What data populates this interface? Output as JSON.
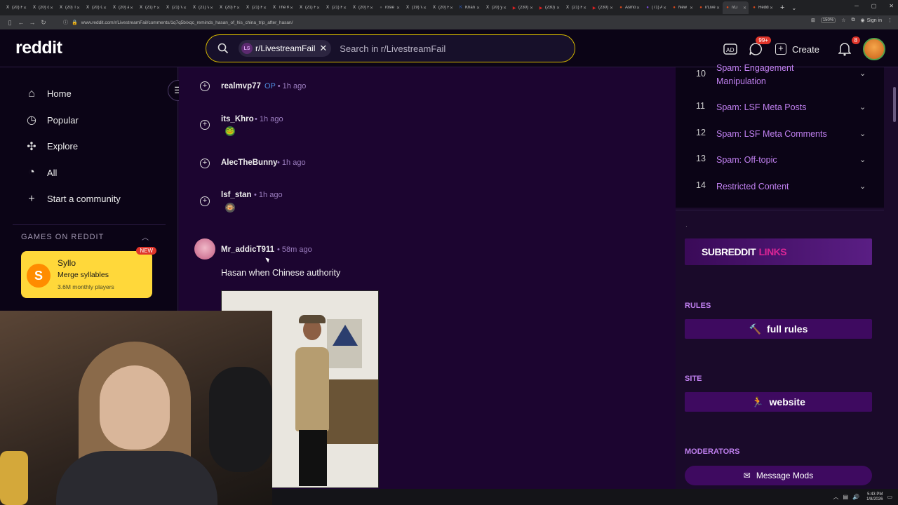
{
  "browser": {
    "tabs": [
      {
        "label": "(20) F",
        "fav": "X",
        "color": "#000000"
      },
      {
        "label": "(20) o",
        "fav": "X",
        "color": "#000000"
      },
      {
        "label": "(20) T",
        "fav": "X",
        "color": "#000000"
      },
      {
        "label": "(20) O",
        "fav": "X",
        "color": "#000000"
      },
      {
        "label": "(20) a",
        "fav": "X",
        "color": "#000000"
      },
      {
        "label": "(21) F",
        "fav": "X",
        "color": "#000000"
      },
      {
        "label": "(21) V",
        "fav": "X",
        "color": "#000000"
      },
      {
        "label": "(21) V",
        "fav": "X",
        "color": "#000000"
      },
      {
        "label": "(20) H",
        "fav": "X",
        "color": "#000000"
      },
      {
        "label": "(21) F",
        "fav": "X",
        "color": "#000000"
      },
      {
        "label": "The K",
        "fav": "X",
        "color": "#000000"
      },
      {
        "label": "(21) F",
        "fav": "X",
        "color": "#000000"
      },
      {
        "label": "(21) F",
        "fav": "X",
        "color": "#000000"
      },
      {
        "label": "(20) F",
        "fav": "X",
        "color": "#000000"
      },
      {
        "label": "rosie",
        "fav": "●",
        "color": "#555555"
      },
      {
        "label": "(19) V",
        "fav": "X",
        "color": "#000000"
      },
      {
        "label": "(20) F",
        "fav": "X",
        "color": "#000000"
      },
      {
        "label": "Khan",
        "fav": "K",
        "color": "#2b5dc9"
      },
      {
        "label": "(20) y",
        "fav": "X",
        "color": "#000000"
      },
      {
        "label": "(230)",
        "fav": "▶",
        "color": "#e02020"
      },
      {
        "label": "(230)",
        "fav": "▶",
        "color": "#e02020"
      },
      {
        "label": "(21) F",
        "fav": "X",
        "color": "#000000"
      },
      {
        "label": "(230)",
        "fav": "▶",
        "color": "#e02020"
      },
      {
        "label": "Asmo",
        "fav": "●",
        "color": "#e04a1a"
      },
      {
        "label": "(71) A",
        "fav": "●",
        "color": "#7a4bd8"
      },
      {
        "label": "New",
        "fav": "●",
        "color": "#e04a1a"
      },
      {
        "label": "r/Live",
        "fav": "●",
        "color": "#e04a1a"
      },
      {
        "label": "r/Li",
        "fav": "●",
        "color": "#e04a1a"
      },
      {
        "label": "Reddi",
        "fav": "●",
        "color": "#e04a1a"
      }
    ],
    "active_tab_index": 27,
    "url": "www.reddit.com/r/LivestreamFail/comments/1q7q5b/xqc_reminds_hasan_of_his_china_trip_after_hasan/",
    "zoom": "150%",
    "signin_label": "Sign in"
  },
  "header": {
    "logo": "reddit",
    "search_chip": "r/LivestreamFail",
    "search_chip_avatar": "LS",
    "search_placeholder": "Search in r/LivestreamFail",
    "chat_badge": "99+",
    "notif_badge": "8",
    "create_label": "Create"
  },
  "left_nav": {
    "items": [
      {
        "icon": "home-icon",
        "glyph": "⌂",
        "label": "Home"
      },
      {
        "icon": "popular-icon",
        "glyph": "◷",
        "label": "Popular"
      },
      {
        "icon": "explore-icon",
        "glyph": "✣",
        "label": "Explore"
      },
      {
        "icon": "all-icon",
        "glyph": "◔",
        "label": "All"
      },
      {
        "icon": "plus-icon",
        "glyph": "+",
        "label": "Start a community"
      }
    ],
    "games_heading": "GAMES ON REDDIT",
    "game": {
      "title": "Syllo",
      "subtitle": "Merge syllables",
      "players": "3.6M monthly players",
      "badge": "NEW",
      "icon_letter": "S"
    }
  },
  "comments": [
    {
      "user": "realmvp77",
      "op": "OP",
      "time": "1h ago"
    },
    {
      "user": "its_Khro",
      "op": "",
      "time": "1h ago",
      "emoji": "🐸"
    },
    {
      "user": "AlecTheBunny",
      "op": "",
      "time": "1h ago"
    },
    {
      "user": "lsf_stan",
      "op": "",
      "time": "1h ago",
      "emoji": "🐵"
    },
    {
      "user": "Mr_addicT911",
      "op": "",
      "time": "58m ago",
      "text": "Hasan when Chinese authority"
    }
  ],
  "rules": [
    {
      "num": "10",
      "title": "Spam: Engagement Manipulation"
    },
    {
      "num": "11",
      "title": "Spam: LSF Meta Posts"
    },
    {
      "num": "12",
      "title": "Spam: LSF Meta Comments"
    },
    {
      "num": "13",
      "title": "Spam: Off-topic"
    },
    {
      "num": "14",
      "title": "Restricted Content"
    }
  ],
  "sidebar": {
    "sublinks_a": "SUBREDDIT",
    "sublinks_b": "LINKS",
    "rules_heading": "RULES",
    "rules_btn": "full rules",
    "site_heading": "SITE",
    "site_btn": "website",
    "mods_heading": "MODERATORS",
    "mods_btn": "Message Mods"
  },
  "taskbar": {
    "time": "5:43 PM",
    "date": "1/8/2026"
  }
}
